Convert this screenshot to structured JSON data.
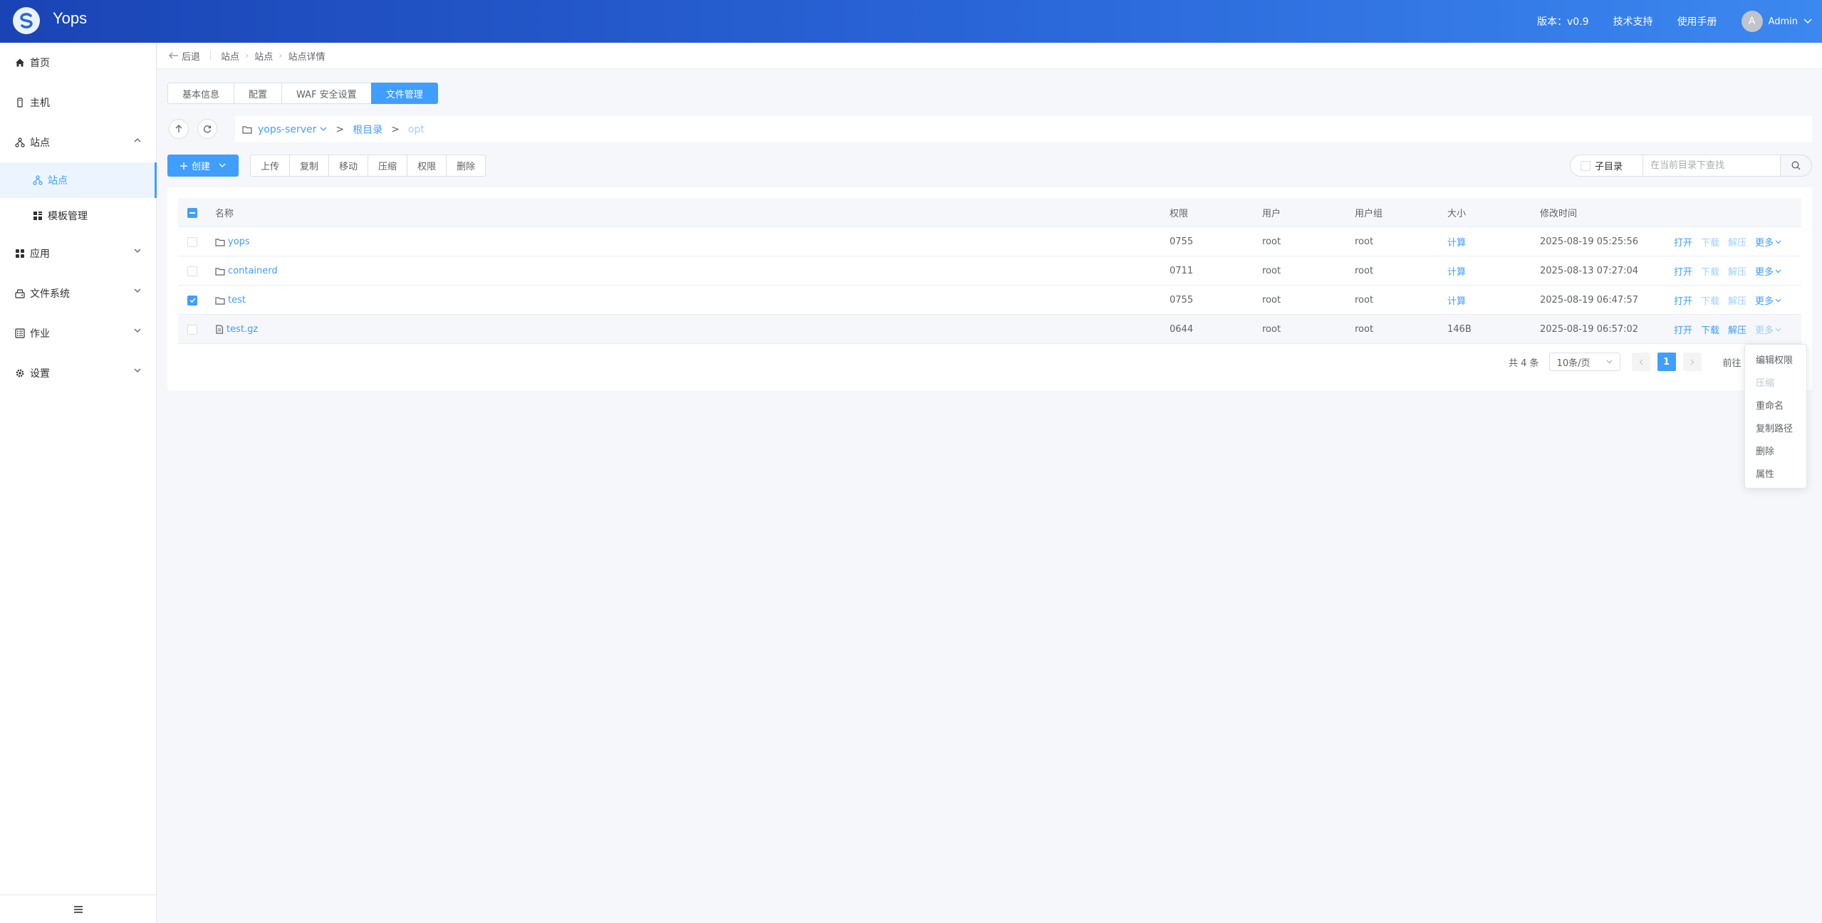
{
  "app": {
    "brand": "Yops",
    "version": "版本：v0.9",
    "support": "技术支持",
    "manual": "使用手册",
    "user_initial": "A",
    "user_name": "Admin"
  },
  "sidebar": {
    "items": [
      {
        "label": "首页",
        "icon": "home-icon"
      },
      {
        "label": "主机",
        "icon": "host-icon"
      },
      {
        "label": "站点",
        "icon": "site-icon"
      },
      {
        "label": "站点",
        "icon": "site-icon"
      },
      {
        "label": "模板管理",
        "icon": "template-icon"
      },
      {
        "label": "应用",
        "icon": "apps-icon"
      },
      {
        "label": "文件系统",
        "icon": "filesystem-icon"
      },
      {
        "label": "作业",
        "icon": "job-icon"
      },
      {
        "label": "设置",
        "icon": "gear-icon"
      }
    ]
  },
  "breadcrumb": {
    "back": "后退",
    "items": [
      "站点",
      "站点",
      "站点详情"
    ]
  },
  "tabs": [
    "基本信息",
    "配置",
    "WAF 安全设置",
    "文件管理"
  ],
  "active_tab": "文件管理",
  "path": {
    "host": "yops-server",
    "sep": ">",
    "root": "根目录",
    "current": "opt"
  },
  "toolbar": {
    "create": "创建",
    "actions": [
      "上传",
      "复制",
      "移动",
      "压缩",
      "权限",
      "删除"
    ],
    "subdir_label": "子目录",
    "search_placeholder": "在当前目录下查找"
  },
  "table": {
    "headers": {
      "name": "名称",
      "perm": "权限",
      "user": "用户",
      "group": "用户组",
      "size": "大小",
      "mtime": "修改时间"
    },
    "rows": [
      {
        "name": "yops",
        "type": "folder",
        "perm": "0755",
        "user": "root",
        "group": "root",
        "size": "计算",
        "mtime": "2025-08-19 05:25:56",
        "checked": false
      },
      {
        "name": "containerd",
        "type": "folder",
        "perm": "0711",
        "user": "root",
        "group": "root",
        "size": "计算",
        "mtime": "2025-08-13 07:27:04",
        "checked": false
      },
      {
        "name": "test",
        "type": "folder",
        "perm": "0755",
        "user": "root",
        "group": "root",
        "size": "计算",
        "mtime": "2025-08-19 06:47:57",
        "checked": true
      },
      {
        "name": "test.gz",
        "type": "file",
        "perm": "0644",
        "user": "root",
        "group": "root",
        "size": "146B",
        "mtime": "2025-08-19 06:57:02",
        "checked": false
      }
    ],
    "ops": {
      "open": "打开",
      "download": "下载",
      "extract": "解压",
      "more": "更多"
    }
  },
  "pagination": {
    "total": "共 4 条",
    "page_size": "10条/页",
    "current_page": "1",
    "goto": "前往"
  },
  "dropdown": {
    "items": [
      {
        "label": "编辑权限",
        "disabled": false
      },
      {
        "label": "压缩",
        "disabled": true
      },
      {
        "label": "重命名",
        "disabled": false
      },
      {
        "label": "复制路径",
        "disabled": false
      },
      {
        "label": "删除",
        "disabled": false
      },
      {
        "label": "属性",
        "disabled": false
      }
    ]
  },
  "colors": {
    "primary": "#409eff",
    "header_start": "#1a44b5",
    "header_end": "#3b88f0"
  }
}
